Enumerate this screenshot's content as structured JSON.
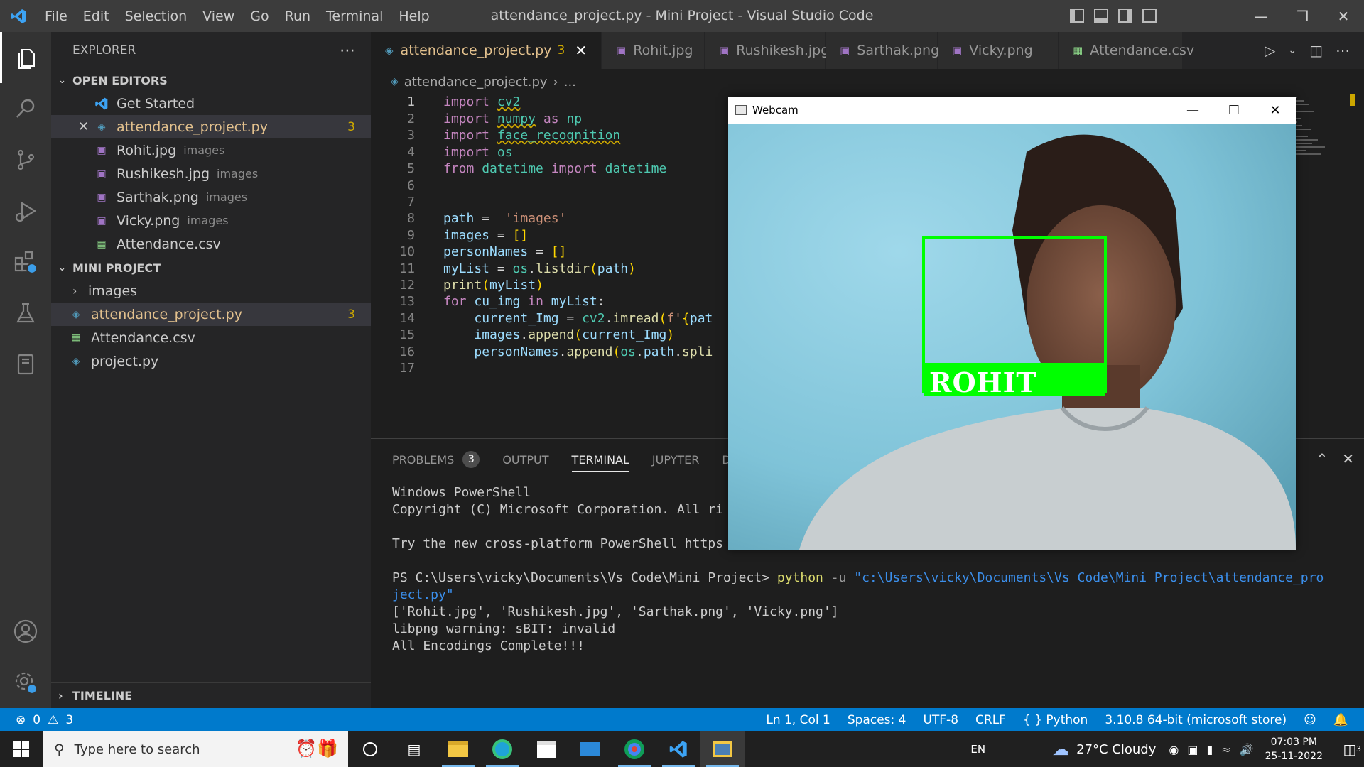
{
  "titlebar": {
    "menu": [
      "File",
      "Edit",
      "Selection",
      "View",
      "Go",
      "Run",
      "Terminal",
      "Help"
    ],
    "title": "attendance_project.py - Mini Project - Visual Studio Code"
  },
  "sidebar": {
    "header": "EXPLORER",
    "open_editors_title": "OPEN EDITORS",
    "open_editors": [
      {
        "label": "Get Started",
        "dir": "",
        "badge": ""
      },
      {
        "label": "attendance_project.py",
        "dir": "",
        "badge": "3"
      },
      {
        "label": "Rohit.jpg",
        "dir": "images",
        "badge": ""
      },
      {
        "label": "Rushikesh.jpg",
        "dir": "images",
        "badge": ""
      },
      {
        "label": "Sarthak.png",
        "dir": "images",
        "badge": ""
      },
      {
        "label": "Vicky.png",
        "dir": "images",
        "badge": ""
      },
      {
        "label": "Attendance.csv",
        "dir": "",
        "badge": ""
      }
    ],
    "project_title": "MINI PROJECT",
    "project_items": [
      {
        "label": "images"
      },
      {
        "label": "attendance_project.py",
        "badge": "3"
      },
      {
        "label": "Attendance.csv"
      },
      {
        "label": "project.py"
      }
    ],
    "timeline": "TIMELINE"
  },
  "tabs": [
    {
      "label": "attendance_project.py",
      "num": "3"
    },
    {
      "label": "Rohit.jpg"
    },
    {
      "label": "Rushikesh.jpg"
    },
    {
      "label": "Sarthak.png"
    },
    {
      "label": "Vicky.png"
    },
    {
      "label": "Attendance.csv"
    }
  ],
  "breadcrumb": {
    "file": "attendance_project.py",
    "rest": "..."
  },
  "code": {
    "line_numbers": [
      "1",
      "2",
      "3",
      "4",
      "5",
      "6",
      "7",
      "8",
      "9",
      "10",
      "11",
      "12",
      "13",
      "14",
      "15",
      "16",
      "17"
    ]
  },
  "panel": {
    "tabs": [
      "PROBLEMS",
      "OUTPUT",
      "TERMINAL",
      "JUPYTER",
      "D"
    ],
    "problems_count": "3",
    "terminal": {
      "line1": "Windows PowerShell",
      "line2": "Copyright (C) Microsoft Corporation. All ri",
      "line3": "Try the new cross-platform PowerShell https",
      "prompt": "PS C:\\Users\\vicky\\Documents\\Vs Code\\Mini Project> ",
      "cmd": "python",
      "arg": " -u ",
      "path1": "\"c:\\Users\\vicky\\Documents\\Vs Code\\Mini Project\\attendance_pro",
      "path2": "ject.py\"",
      "out1": "['Rohit.jpg', 'Rushikesh.jpg', 'Sarthak.png', 'Vicky.png']",
      "out2": "libpng warning: sBIT: invalid",
      "out3": "All Encodings Complete!!!"
    }
  },
  "webcam": {
    "title": "Webcam",
    "label": "ROHIT"
  },
  "statusbar": {
    "errors": "0",
    "warnings": "3",
    "position": "Ln 1, Col 1",
    "spaces": "Spaces: 4",
    "encoding": "UTF-8",
    "eol": "CRLF",
    "language": "Python",
    "interpreter": "3.10.8 64-bit (microsoft store)"
  },
  "taskbar": {
    "search_placeholder": "Type here to search",
    "lang": "EN",
    "weather": "27°C  Cloudy",
    "time": "07:03 PM",
    "date": "25-11-2022",
    "notif_count": "3"
  },
  "colors": {
    "accent": "#007acc",
    "face_box": "#00ff00",
    "modified_file": "#e2c08d",
    "warning_badge": "#cca700"
  }
}
